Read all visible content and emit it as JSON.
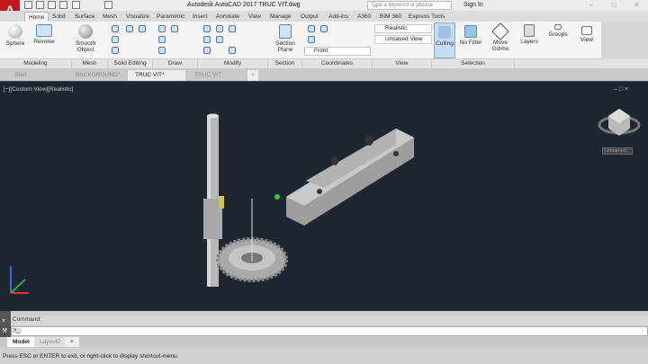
{
  "app": {
    "title": "Autodesk AutoCAD 2017    TRUC VIT.dwg",
    "logo": "A",
    "search_placeholder": "Type a keyword or phrase",
    "sign_in": "Sign In"
  },
  "ribbon_tabs": [
    "Home",
    "Solid",
    "Surface",
    "Mesh",
    "Visualize",
    "Parametric",
    "Insert",
    "Annotate",
    "View",
    "Manage",
    "Output",
    "Add-ins",
    "A360",
    "BIM 360",
    "Express Tools"
  ],
  "active_tab": "Home",
  "tools": {
    "sphere": "Sphere",
    "revolve": "Revolve",
    "smooth_object": "Smooth Object",
    "section_plane": "Section Plane",
    "visual_style": "Realistic",
    "named_view": "Unsaved View",
    "ucs_view": "Front",
    "culling": "Culling",
    "no_filter": "No Filter",
    "move_gizmo": "Move Gizmo",
    "layers": "Layers",
    "groups": "Groups",
    "view": "View"
  },
  "panels": [
    "Modeling",
    "Mesh",
    "Solid Editing",
    "Draw",
    "Modify",
    "Section",
    "Coordinates",
    "View",
    "Selection"
  ],
  "file_tabs": [
    "Start",
    "BACKGROUND*",
    "TRUC VIT*",
    "TRUC VIT"
  ],
  "active_file_tab": "TRUC VIT*",
  "viewport": {
    "label": "[−][Custom View][Realistic]",
    "viewcube_label": "Unnamed",
    "background": "#1e2631"
  },
  "command": {
    "history": "Command:",
    "prompt": ">_"
  },
  "layout_tabs": [
    "Model",
    "Layout2"
  ],
  "status": "Press ESC or ENTER to exit, or right-click to display shortcut-menu."
}
